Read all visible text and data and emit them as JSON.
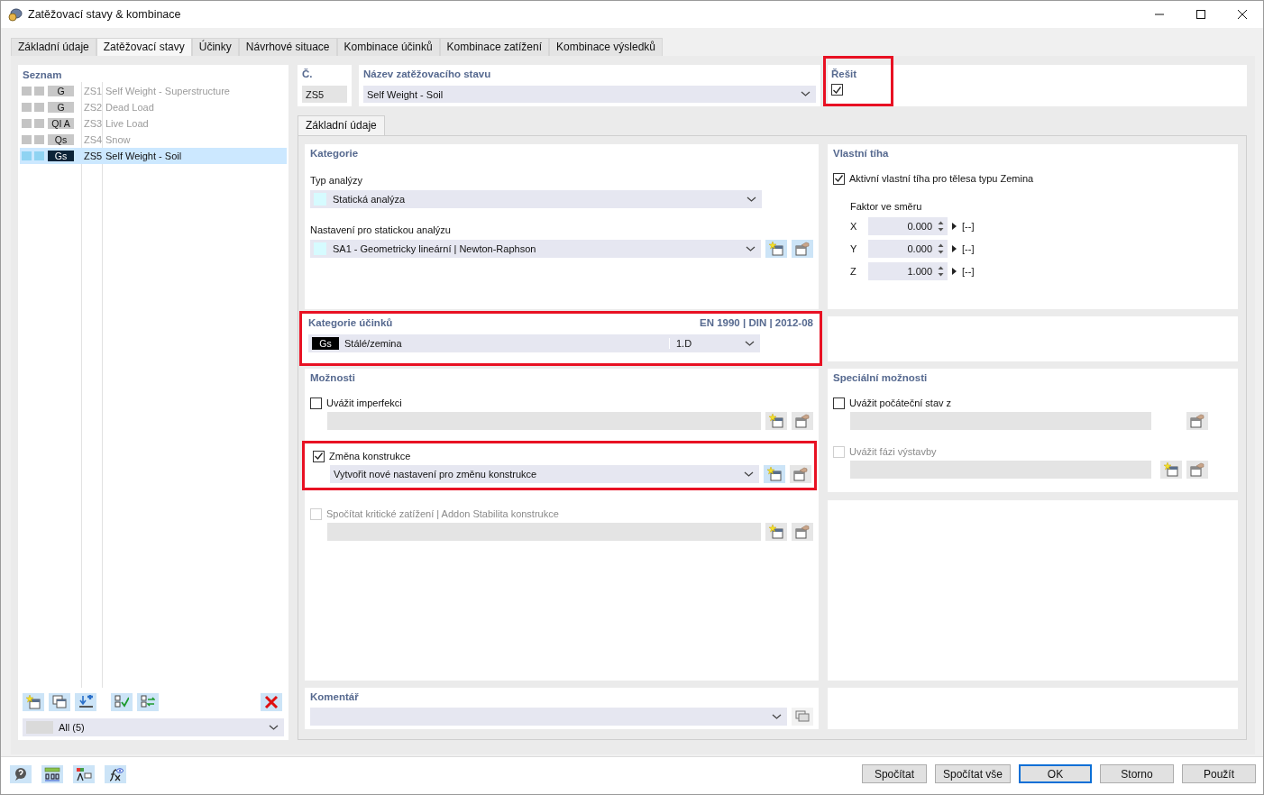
{
  "window": {
    "title": "Zatěžovací stavy & kombinace"
  },
  "tabs": [
    {
      "label": "Základní údaje",
      "selected": false
    },
    {
      "label": "Zatěžovací stavy",
      "selected": true
    },
    {
      "label": "Účinky",
      "selected": false
    },
    {
      "label": "Návrhové situace",
      "selected": false
    },
    {
      "label": "Kombinace účinků",
      "selected": false
    },
    {
      "label": "Kombinace zatížení",
      "selected": false
    },
    {
      "label": "Kombinace výsledků",
      "selected": false
    }
  ],
  "list": {
    "title": "Seznam",
    "items": [
      {
        "tag": "G",
        "color": "#c8c8c8",
        "number": "ZS1",
        "name": "Self Weight - Superstructure",
        "dimmed": true,
        "selected": false
      },
      {
        "tag": "G",
        "color": "#c8c8c8",
        "number": "ZS2",
        "name": "Dead Load",
        "dimmed": true,
        "selected": false
      },
      {
        "tag": "QI A",
        "color": "#c8c8c8",
        "number": "ZS3",
        "name": "Live Load",
        "dimmed": true,
        "selected": false
      },
      {
        "tag": "Qs",
        "color": "#c8c8c8",
        "number": "ZS4",
        "name": "Snow",
        "dimmed": true,
        "selected": false
      },
      {
        "tag": "Gs",
        "color": "#0c2338",
        "number": "ZS5",
        "name": "Self Weight - Soil",
        "dimmed": false,
        "selected": true
      }
    ],
    "filter": "All (5)"
  },
  "number": {
    "label": "Č.",
    "value": "ZS5"
  },
  "name": {
    "label": "Název zatěžovacího stavu",
    "value": "Self Weight - Soil"
  },
  "solve": {
    "label": "Řešit",
    "checked": true,
    "highlighted": true
  },
  "subtabs": [
    {
      "label": "Základní údaje",
      "selected": true
    }
  ],
  "category": {
    "title": "Kategorie",
    "analysis_type": {
      "label": "Typ analýzy",
      "value": "Statická analýza",
      "color": "#d6fbff"
    },
    "static_settings": {
      "label": "Nastavení pro statickou analýzu",
      "value": "SA1 - Geometricky lineární | Newton-Raphson",
      "color": "#d6fbff"
    }
  },
  "action_category": {
    "title": "Kategorie účinků",
    "standard": "EN 1990 | DIN | 2012-08",
    "tag": "Gs",
    "color": "#000000",
    "value": "Stálé/zemina",
    "code": "1.D",
    "highlighted": true
  },
  "self_weight": {
    "title": "Vlastní tíha",
    "active": {
      "label": "Aktivní vlastní tíha pro tělesa typu Zemina",
      "checked": true
    },
    "factor_label": "Faktor ve směru",
    "factors": [
      {
        "axis": "X",
        "value": "0.000",
        "unit": "[--]"
      },
      {
        "axis": "Y",
        "value": "0.000",
        "unit": "[--]"
      },
      {
        "axis": "Z",
        "value": "1.000",
        "unit": "[--]"
      }
    ]
  },
  "options": {
    "title": "Možnosti",
    "items": [
      {
        "label": "Uvážit imperfekci",
        "checked": false,
        "disabled": false,
        "highlighted": false
      },
      {
        "label": "Změna konstrukce",
        "checked": true,
        "disabled": false,
        "highlighted": true,
        "value": "Vytvořit nové nastavení pro změnu konstrukce"
      },
      {
        "label": "Spočítat kritické zatížení | Addon Stabilita konstrukce",
        "checked": false,
        "disabled": true,
        "highlighted": false
      }
    ]
  },
  "special_options": {
    "title": "Speciální možnosti",
    "items": [
      {
        "label": "Uvážit počáteční stav z",
        "checked": false,
        "disabled": false,
        "tools": [
          {
            "kind": "edit"
          }
        ]
      },
      {
        "label": "Uvážit fázi výstavby",
        "checked": false,
        "disabled": true,
        "tools": [
          {
            "kind": "new"
          },
          {
            "kind": "edit"
          }
        ]
      }
    ]
  },
  "comment": {
    "title": "Komentář"
  },
  "buttons": [
    {
      "label": "Spočítat",
      "default": false
    },
    {
      "label": "Spočítat vše",
      "default": false
    },
    {
      "label": "OK",
      "default": true
    },
    {
      "label": "Storno",
      "default": false
    },
    {
      "label": "Použít",
      "default": false
    }
  ]
}
